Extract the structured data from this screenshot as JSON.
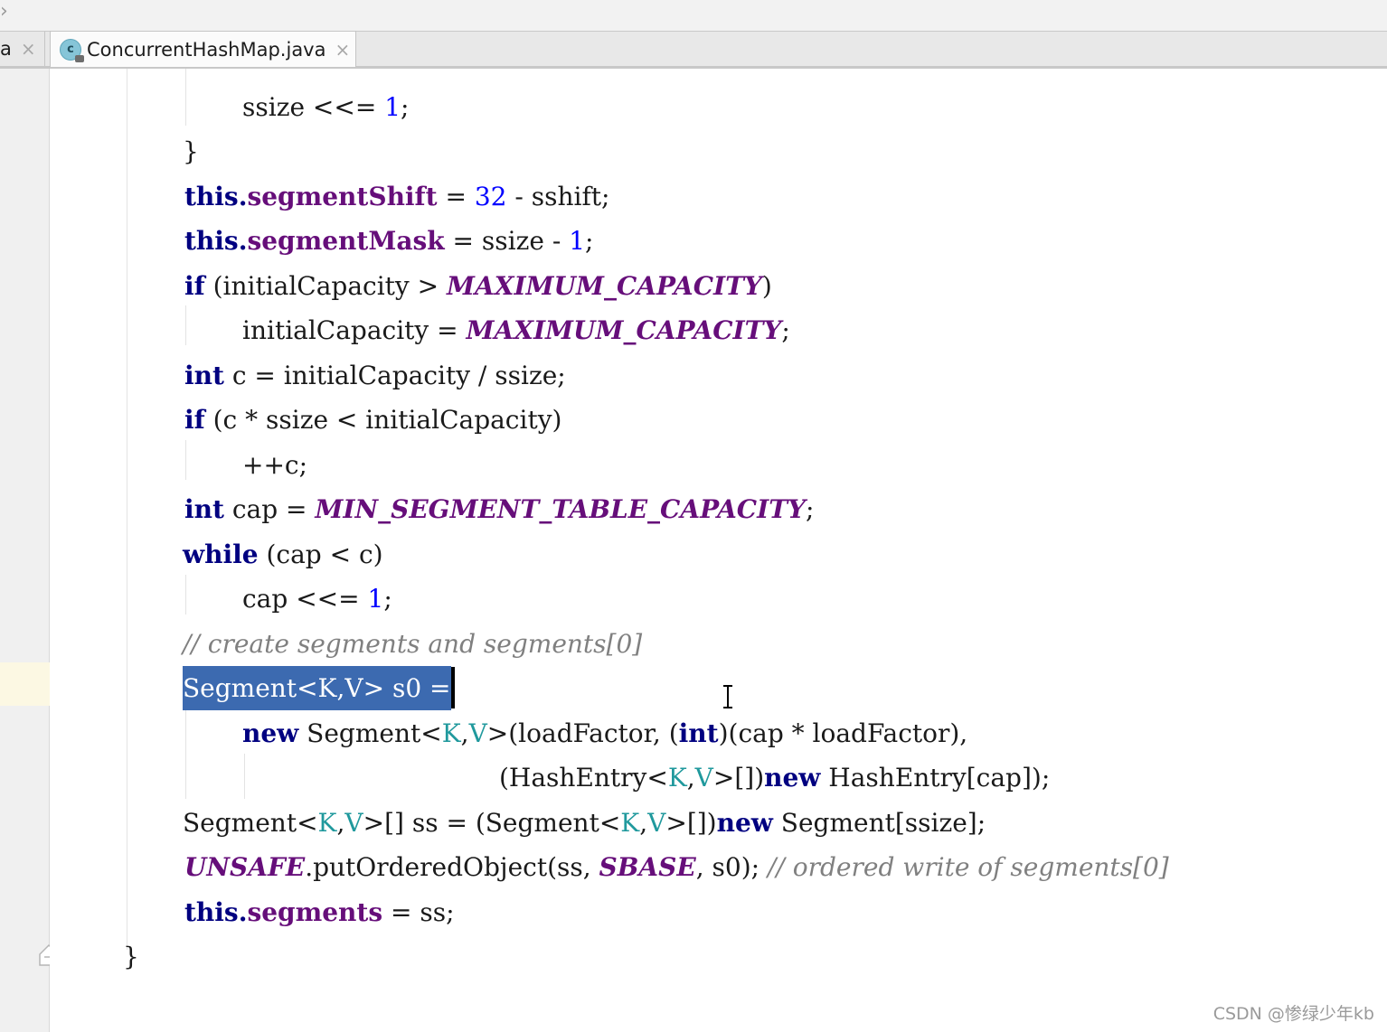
{
  "tabs": {
    "previous_tab_label": "a",
    "previous_close": "×",
    "active_tab_label": "ConcurrentHashMap.java",
    "active_icon_letter": "c",
    "active_close": "×"
  },
  "code_lines": [
    [
      "ssize <<= ",
      "1",
      ";"
    ],
    [
      "}"
    ],
    [
      "this.",
      "segmentShift",
      " = ",
      "32",
      " - sshift;"
    ],
    [
      "this.",
      "segmentMask",
      " = ssize - ",
      "1",
      ";"
    ],
    [
      "if",
      " (initialCapacity > ",
      "MAXIMUM_CAPACITY",
      ")"
    ],
    [
      "initialCapacity = ",
      "MAXIMUM_CAPACITY",
      ";"
    ],
    [
      "int",
      " c = initialCapacity / ssize;"
    ],
    [
      "if",
      " (c * ssize < initialCapacity)"
    ],
    [
      "++c;"
    ],
    [
      "int",
      " cap = ",
      "MIN_SEGMENT_TABLE_CAPACITY",
      ";"
    ],
    [
      "while",
      " (cap < c)"
    ],
    [
      "cap <<= ",
      "1",
      ";"
    ],
    [
      "// create segments and segments[0]"
    ],
    [
      "Segment<",
      "K",
      ",",
      "V",
      "> s0 ="
    ],
    [
      "new",
      " Segment<",
      "K",
      ",",
      "V",
      ">(loadFactor, (",
      "int",
      ")(cap * loadFactor),"
    ],
    [
      "(HashEntry<",
      "K",
      ",",
      "V",
      ">[])",
      "new",
      " HashEntry[cap]);"
    ],
    [
      "Segment<",
      "K",
      ",",
      "V",
      ">[] ss = (Segment<",
      "K",
      ",",
      "V",
      ">[])",
      "new",
      " Segment[ssize];"
    ],
    [
      "UNSAFE",
      ".putOrderedObject(ss, ",
      "SBASE",
      ", s0); ",
      "// ordered write of segments[0]"
    ],
    [
      "this.",
      "segments",
      " = ss;"
    ],
    [
      "}"
    ]
  ],
  "watermark": "CSDN @惨绿少年kb",
  "colors": {
    "keyword": "#000080",
    "field": "#660e7a",
    "number": "#0000ff",
    "generic": "#20999d",
    "comment": "#808080",
    "selection": "#3c6ab0",
    "current_line": "#fcf8e3"
  },
  "icons": [
    "class-icon",
    "close-icon",
    "fold-icon",
    "text-cursor-icon"
  ]
}
